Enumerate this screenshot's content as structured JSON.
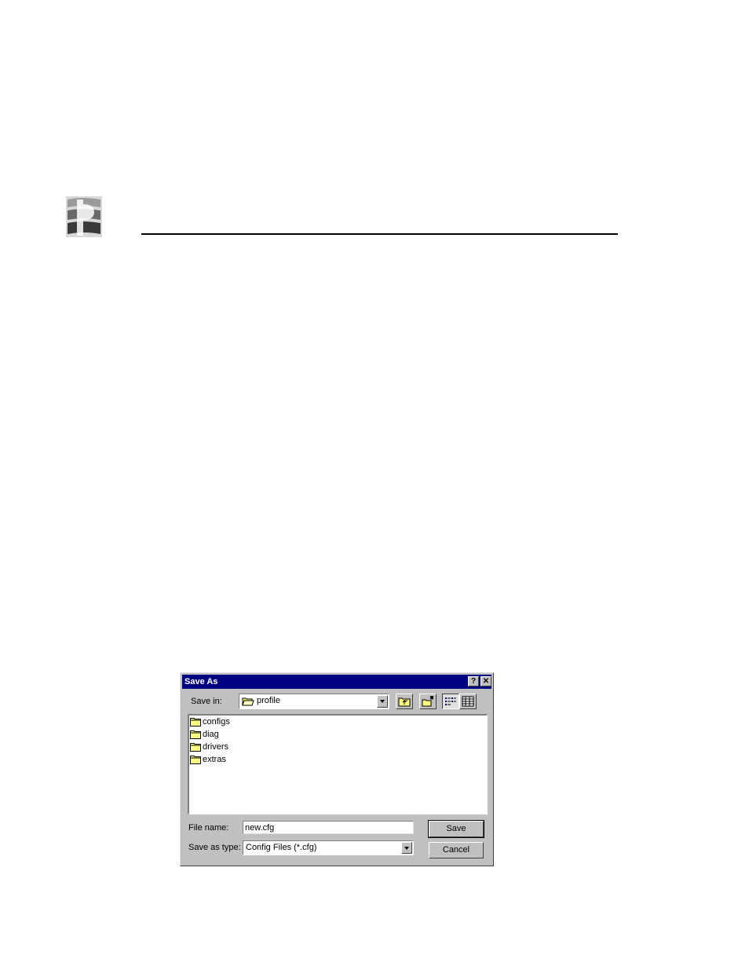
{
  "dialog": {
    "title": "Save As",
    "help_glyph": "?",
    "close_glyph": "✕",
    "save_in_label": "Save in:",
    "save_in_value": "profile",
    "toolbar_icons": [
      "up-one-level-icon",
      "create-new-folder-icon",
      "list-view-icon",
      "details-view-icon"
    ],
    "files": [
      {
        "name": "configs",
        "icon": "folder-icon"
      },
      {
        "name": "diag",
        "icon": "folder-icon"
      },
      {
        "name": "drivers",
        "icon": "folder-icon"
      },
      {
        "name": "extras",
        "icon": "folder-icon"
      }
    ],
    "file_name_label": "File name:",
    "file_name_value": "new.cfg",
    "save_as_type_label": "Save as type:",
    "save_as_type_value": "Config Files (*.cfg)",
    "save_button": "Save",
    "cancel_button": "Cancel"
  },
  "colors": {
    "titlebar": "#000080",
    "face": "#c0c0c0",
    "folder": "#ffff80"
  }
}
